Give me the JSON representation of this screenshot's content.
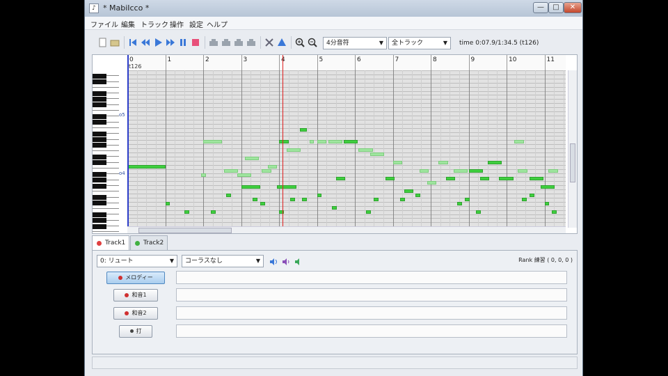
{
  "window": {
    "title": "* MabiIcco *",
    "icon": "app-icon",
    "min": "—",
    "max": "□",
    "close": "✕"
  },
  "menu": [
    "ファイル",
    "編集",
    "トラック",
    "操作",
    "設定",
    "ヘルプ"
  ],
  "toolbar": {
    "note_length": "4分音符",
    "track_filter": "全トラック",
    "time": "time 0:07.9/1:34.5 (t126)"
  },
  "editor": {
    "measures": [
      "0",
      "1",
      "2",
      "3",
      "4",
      "5",
      "6",
      "7",
      "8",
      "9",
      "10",
      "11"
    ],
    "tick_label": "t126",
    "octave_labels": [
      "o5",
      "o4"
    ],
    "playhead_measure": 4.1
  },
  "tabs": [
    {
      "label": "Track1",
      "color": "#e04040"
    },
    {
      "label": "Track2",
      "color": "#40b040"
    }
  ],
  "track": {
    "instrument": "0: リュート",
    "chorus": "コーラスなし",
    "rank": "Rank 練習 ( 0, 0, 0 )",
    "parts": [
      {
        "label": "メロディー"
      },
      {
        "label": "和音1"
      },
      {
        "label": "和音2"
      },
      {
        "label": "打"
      }
    ]
  },
  "colors": {
    "note": "#3fcf3f",
    "playhead": "#e02020",
    "start_line": "#2b3cc8"
  }
}
